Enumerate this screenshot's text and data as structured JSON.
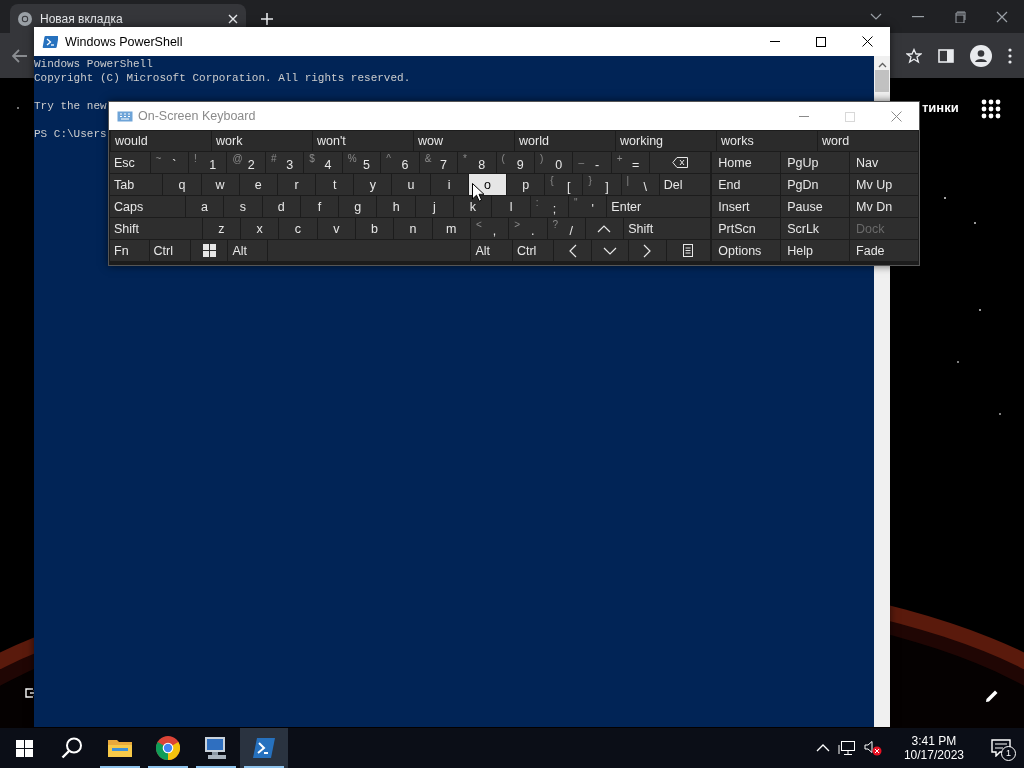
{
  "browser": {
    "tab": {
      "title": "Новая вкладка"
    },
    "page": {
      "link": "тинки"
    }
  },
  "powershell": {
    "title": "Windows PowerShell",
    "blocks": [
      [
        "Windows PowerShell",
        "Copyright (C) Microsoft Corporation. All rights reserved."
      ],
      [
        "Try the new"
      ],
      [
        "PS C:\\Users"
      ]
    ]
  },
  "osk": {
    "title": "On-Screen Keyboard",
    "maximize_disabled": true,
    "predictions": [
      "would",
      "work",
      "won't",
      "wow",
      "world",
      "working",
      "works",
      "word"
    ],
    "rows": [
      [
        {
          "kind": "text",
          "label": "Esc",
          "hovered": false
        },
        {
          "kind": "text",
          "shift": "~",
          "label": "`",
          "hovered": false
        },
        {
          "kind": "text",
          "shift": "!",
          "label": "1",
          "hovered": false
        },
        {
          "kind": "text",
          "shift": "@",
          "label": "2",
          "hovered": false
        },
        {
          "kind": "text",
          "shift": "#",
          "label": "3",
          "hovered": false
        },
        {
          "kind": "text",
          "shift": "$",
          "label": "4",
          "hovered": false
        },
        {
          "kind": "text",
          "shift": "%",
          "label": "5",
          "hovered": false
        },
        {
          "kind": "text",
          "shift": "^",
          "label": "6",
          "hovered": false
        },
        {
          "kind": "text",
          "shift": "&",
          "label": "7",
          "hovered": false
        },
        {
          "kind": "text",
          "shift": "*",
          "label": "8",
          "hovered": false
        },
        {
          "kind": "text",
          "shift": "(",
          "label": "9",
          "hovered": false
        },
        {
          "kind": "text",
          "shift": ")",
          "label": "0",
          "hovered": false
        },
        {
          "kind": "text",
          "shift": "_",
          "label": "-",
          "hovered": false
        },
        {
          "kind": "text",
          "shift": "+",
          "label": "=",
          "hovered": false
        },
        {
          "kind": "backspace",
          "hovered": false
        }
      ],
      [
        {
          "kind": "text",
          "label": "Tab",
          "hovered": false
        },
        {
          "kind": "text",
          "label": "q",
          "hovered": false
        },
        {
          "kind": "text",
          "label": "w",
          "hovered": false
        },
        {
          "kind": "text",
          "label": "e",
          "hovered": false
        },
        {
          "kind": "text",
          "label": "r",
          "hovered": false
        },
        {
          "kind": "text",
          "label": "t",
          "hovered": false
        },
        {
          "kind": "text",
          "label": "y",
          "hovered": false
        },
        {
          "kind": "text",
          "label": "u",
          "hovered": false
        },
        {
          "kind": "text",
          "label": "i",
          "hovered": false
        },
        {
          "kind": "text",
          "label": "o",
          "hovered": true
        },
        {
          "kind": "text",
          "label": "p",
          "hovered": false
        },
        {
          "kind": "text",
          "shift": "{",
          "label": "[",
          "hovered": false
        },
        {
          "kind": "text",
          "shift": "}",
          "label": "]",
          "hovered": false
        },
        {
          "kind": "text",
          "shift": "|",
          "label": "\\",
          "hovered": false
        },
        {
          "kind": "text",
          "label": "Del",
          "hovered": false
        }
      ],
      [
        {
          "kind": "text",
          "label": "Caps",
          "hovered": false
        },
        {
          "kind": "text",
          "label": "a",
          "hovered": false
        },
        {
          "kind": "text",
          "label": "s",
          "hovered": false
        },
        {
          "kind": "text",
          "label": "d",
          "hovered": false
        },
        {
          "kind": "text",
          "label": "f",
          "hovered": false
        },
        {
          "kind": "text",
          "label": "g",
          "hovered": false
        },
        {
          "kind": "text",
          "label": "h",
          "hovered": false
        },
        {
          "kind": "text",
          "label": "j",
          "hovered": false
        },
        {
          "kind": "text",
          "label": "k",
          "hovered": false
        },
        {
          "kind": "text",
          "label": "l",
          "hovered": false
        },
        {
          "kind": "text",
          "shift": ":",
          "label": ";",
          "hovered": false
        },
        {
          "kind": "text",
          "shift": "\"",
          "label": "'",
          "hovered": false
        },
        {
          "kind": "text",
          "label": "Enter",
          "hovered": false
        }
      ],
      [
        {
          "kind": "text",
          "label": "Shift",
          "hovered": false
        },
        {
          "kind": "text",
          "label": "z",
          "hovered": false
        },
        {
          "kind": "text",
          "label": "x",
          "hovered": false
        },
        {
          "kind": "text",
          "label": "c",
          "hovered": false
        },
        {
          "kind": "text",
          "label": "v",
          "hovered": false
        },
        {
          "kind": "text",
          "label": "b",
          "hovered": false
        },
        {
          "kind": "text",
          "label": "n",
          "hovered": false
        },
        {
          "kind": "text",
          "label": "m",
          "hovered": false
        },
        {
          "kind": "text",
          "shift": "<",
          "label": ",",
          "hovered": false
        },
        {
          "kind": "text",
          "shift": ">",
          "label": ".",
          "hovered": false
        },
        {
          "kind": "text",
          "shift": "?",
          "label": "/",
          "hovered": false
        },
        {
          "kind": "up",
          "hovered": false
        },
        {
          "kind": "text",
          "label": "Shift",
          "hovered": false
        }
      ],
      [
        {
          "kind": "text",
          "label": "Fn",
          "hovered": false
        },
        {
          "kind": "text",
          "label": "Ctrl",
          "hovered": false
        },
        {
          "kind": "windows",
          "hovered": false
        },
        {
          "kind": "text",
          "label": "Alt",
          "hovered": false
        },
        {
          "kind": "space",
          "hovered": false
        },
        {
          "kind": "text",
          "label": "Alt",
          "hovered": false
        },
        {
          "kind": "text",
          "label": "Ctrl",
          "hovered": false
        },
        {
          "kind": "left",
          "hovered": false
        },
        {
          "kind": "down",
          "hovered": false
        },
        {
          "kind": "right",
          "hovered": false
        },
        {
          "kind": "menu",
          "hovered": false
        }
      ]
    ],
    "nav_keys": [
      {
        "label": "Home",
        "disabled": false
      },
      {
        "label": "PgUp",
        "disabled": false
      },
      {
        "label": "Nav",
        "disabled": false
      },
      {
        "label": "End",
        "disabled": false
      },
      {
        "label": "PgDn",
        "disabled": false
      },
      {
        "label": "Mv Up",
        "disabled": false
      },
      {
        "label": "Insert",
        "disabled": false
      },
      {
        "label": "Pause",
        "disabled": false
      },
      {
        "label": "Mv Dn",
        "disabled": false
      },
      {
        "label": "PrtScn",
        "disabled": false
      },
      {
        "label": "ScrLk",
        "disabled": false
      },
      {
        "label": "Dock",
        "disabled": true
      },
      {
        "label": "Options",
        "disabled": false
      },
      {
        "label": "Help",
        "disabled": false
      },
      {
        "label": "Fade",
        "disabled": false
      }
    ]
  },
  "taskbar": {
    "apps": [
      {
        "kind": "folder",
        "running": true,
        "active": false
      },
      {
        "kind": "chrome",
        "running": true,
        "active": false
      },
      {
        "kind": "computer",
        "running": true,
        "active": false
      },
      {
        "kind": "powershell",
        "running": true,
        "active": true
      }
    ],
    "time": "3:41 PM",
    "date": "10/17/2023",
    "notifications": "1"
  }
}
